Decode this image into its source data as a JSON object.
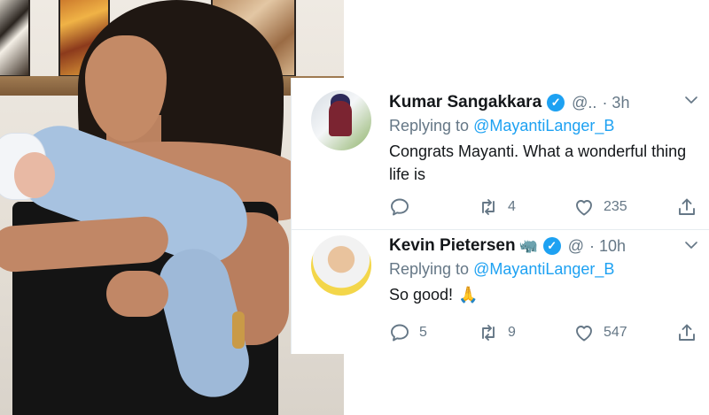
{
  "tweets": [
    {
      "name": "Kumar Sangakkara",
      "handle": "@..",
      "time": "· 3h",
      "reply_prefix": "Replying to",
      "reply_to": "@MayantiLanger_B",
      "text": "Congrats Mayanti. What a wonderful thing life is",
      "reply_count": "",
      "retweet_count": "4",
      "like_count": "235",
      "verified": true
    },
    {
      "name": "Kevin Pietersen",
      "handle": "@",
      "time": "· 10h",
      "reply_prefix": "Replying to",
      "reply_to": "@MayantiLanger_B",
      "text": "So good!",
      "reply_count": "5",
      "retweet_count": "9",
      "like_count": "547",
      "verified": true
    }
  ],
  "icons": {
    "reply": "reply-icon",
    "retweet": "retweet-icon",
    "like": "heart-icon",
    "share": "share-icon",
    "more": "chevron-down-icon",
    "verified": "verified-badge-icon",
    "rhino_emoji": "rhino-emoji-icon",
    "pray_emoji": "folded-hands-emoji-icon"
  },
  "colors": {
    "accent": "#1da1f2",
    "text": "#14171a",
    "muted": "#657786",
    "divider": "#e6ecf0"
  }
}
